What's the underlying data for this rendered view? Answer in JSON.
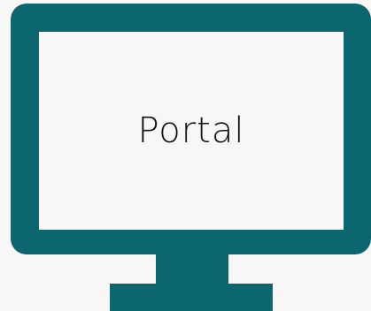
{
  "screen": {
    "label": "Portal",
    "icon": "monitor-icon"
  },
  "colors": {
    "frame": "#0b6670",
    "screen": "#f7f7f7",
    "background": "#f7f7f7",
    "text": "#111111"
  }
}
